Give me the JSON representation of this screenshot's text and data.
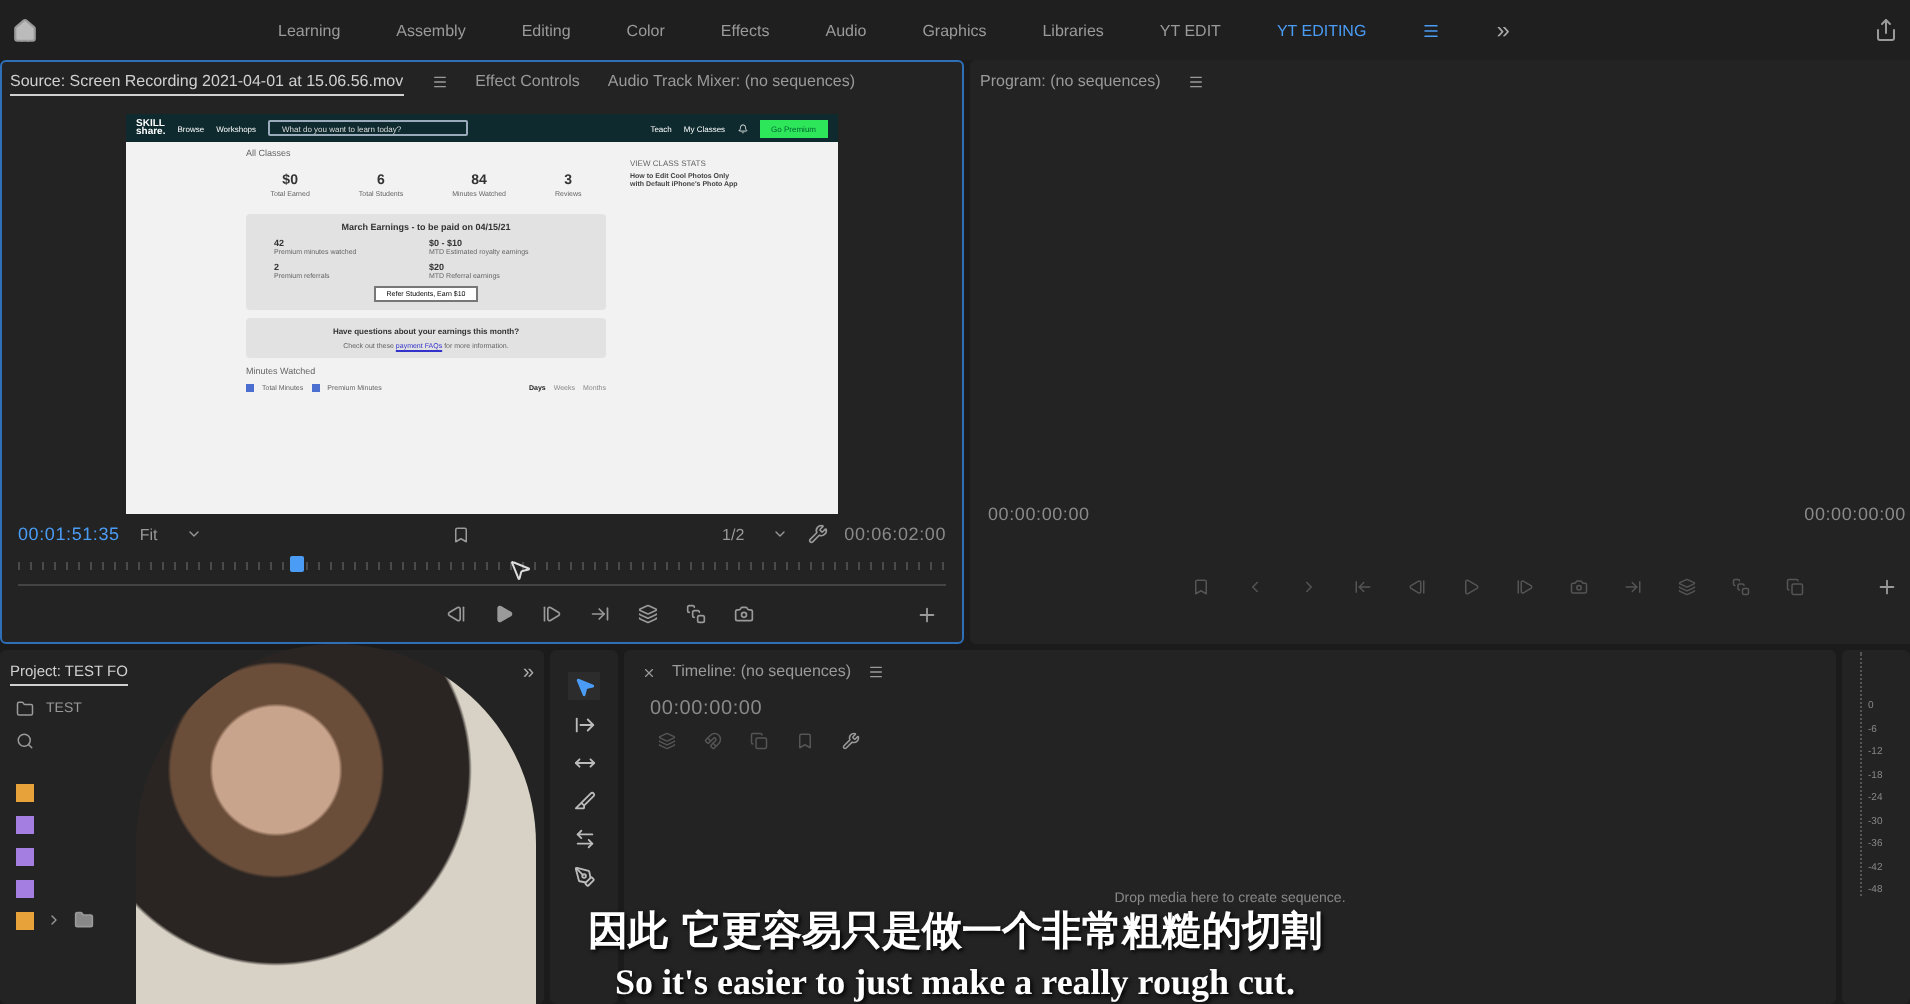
{
  "workspace_bar": {
    "tabs": [
      {
        "label": "Learning",
        "selected": false
      },
      {
        "label": "Assembly",
        "selected": false
      },
      {
        "label": "Editing",
        "selected": false
      },
      {
        "label": "Color",
        "selected": false
      },
      {
        "label": "Effects",
        "selected": false
      },
      {
        "label": "Audio",
        "selected": false
      },
      {
        "label": "Graphics",
        "selected": false
      },
      {
        "label": "Libraries",
        "selected": false
      },
      {
        "label": "YT EDIT",
        "selected": false
      },
      {
        "label": "YT EDITING",
        "selected": true
      }
    ],
    "overflow": "»"
  },
  "source_panel": {
    "tabs": [
      {
        "label": "Source: Screen Recording 2021-04-01 at 15.06.56.mov",
        "selected": true
      },
      {
        "label": "Effect Controls",
        "selected": false
      },
      {
        "label": "Audio Track Mixer: (no sequences)",
        "selected": false
      }
    ],
    "screen": {
      "logo": [
        "SKILL",
        "share."
      ],
      "nav": [
        "Browse",
        "Workshops"
      ],
      "search_placeholder": "What do you want to learn today?",
      "nav_right": [
        "Teach",
        "My Classes"
      ],
      "cta": "Go Premium",
      "heading": "All Classes",
      "stats": [
        {
          "value": "$0",
          "label": "Total Earned"
        },
        {
          "value": "6",
          "label": "Total Students"
        },
        {
          "value": "84",
          "label": "Minutes Watched"
        },
        {
          "value": "3",
          "label": "Reviews"
        }
      ],
      "earnings": {
        "title": "March Earnings - to be paid on 04/15/21",
        "items": [
          {
            "value": "42",
            "label": "Premium minutes watched"
          },
          {
            "value": "$0 - $10",
            "label": "MTD Estimated royalty earnings"
          },
          {
            "value": "2",
            "label": "Premium referrals"
          },
          {
            "value": "$20",
            "label": "MTD Referral earnings"
          }
        ],
        "button": "Refer Students, Earn $10"
      },
      "faq": {
        "question": "Have questions about your earnings this month?",
        "text_before": "Check out these",
        "link": "payment FAQs",
        "text_after": "for more information."
      },
      "chart_title": "Minutes Watched",
      "legend": [
        {
          "label": "Total Minutes",
          "checked": true
        },
        {
          "label": "Premium Minutes",
          "checked": true
        }
      ],
      "periods": [
        {
          "label": "Days",
          "selected": true
        },
        {
          "label": "Weeks",
          "selected": false
        },
        {
          "label": "Months",
          "selected": false
        }
      ],
      "side": {
        "heading": "VIEW CLASS STATS",
        "title": "How to Edit Cool Photos Only with Default iPhone's Photo App"
      }
    },
    "current_time": "00:01:51:35",
    "zoom": "Fit",
    "resolution": "1/2",
    "duration": "00:06:02:00",
    "scrubber": {
      "level": 0.3
    }
  },
  "program_panel": {
    "title": "Program: (no sequences)",
    "in_time": "00:00:00:00",
    "out_time": "00:00:00:00"
  },
  "project_panel": {
    "title": "Project: TEST FO",
    "overflow": "»",
    "bin": "TEST",
    "items": [
      {
        "kind": "clip",
        "color": "#e8a23a"
      },
      {
        "kind": "clip",
        "color": "#a47ee0"
      },
      {
        "kind": "clip",
        "color": "#a47ee0"
      },
      {
        "kind": "clip",
        "color": "#a47ee0"
      },
      {
        "kind": "bin",
        "color": "#e8a23a"
      }
    ]
  },
  "tools": [
    {
      "kind": "selection",
      "selected": true
    },
    {
      "kind": "track-select",
      "selected": false
    },
    {
      "kind": "ripple",
      "selected": false
    },
    {
      "kind": "razor",
      "selected": false
    },
    {
      "kind": "slip",
      "selected": false
    },
    {
      "kind": "pen",
      "selected": false
    }
  ],
  "timeline": {
    "title": "Timeline: (no sequences)",
    "timecode": "00:00:00:00",
    "hint": "Drop media here to create sequence."
  },
  "audio_meter": {
    "ticks": [
      "0",
      "-6",
      "-12",
      "-18",
      "-24",
      "-30",
      "-36",
      "-42",
      "-48"
    ]
  },
  "subtitles": {
    "chinese": "因此 它更容易只是做一个非常粗糙的切割",
    "english": "So it's easier to just make a really rough cut."
  }
}
